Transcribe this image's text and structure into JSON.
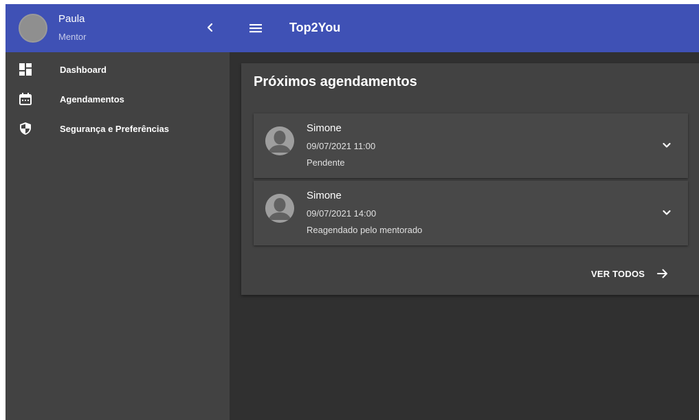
{
  "sidebar": {
    "user": {
      "name": "Paula",
      "role": "Mentor"
    },
    "items": [
      {
        "label": "Dashboard",
        "icon": "dashboard-icon"
      },
      {
        "label": "Agendamentos",
        "icon": "calendar-icon"
      },
      {
        "label": "Segurança e Preferências",
        "icon": "shield-icon"
      }
    ]
  },
  "topbar": {
    "title": "Top2You"
  },
  "card": {
    "title": "Próximos agendamentos",
    "appointments": [
      {
        "name": "Simone",
        "datetime": "09/07/2021 11:00",
        "status": "Pendente"
      },
      {
        "name": "Simone",
        "datetime": "09/07/2021 14:00",
        "status": "Reagendado pelo mentorado"
      }
    ],
    "view_all_label": "VER TODOS"
  },
  "colors": {
    "primary": "#3f51b5",
    "sidebar_bg": "#424242",
    "content_bg": "#303030",
    "card_bg": "#424242"
  }
}
